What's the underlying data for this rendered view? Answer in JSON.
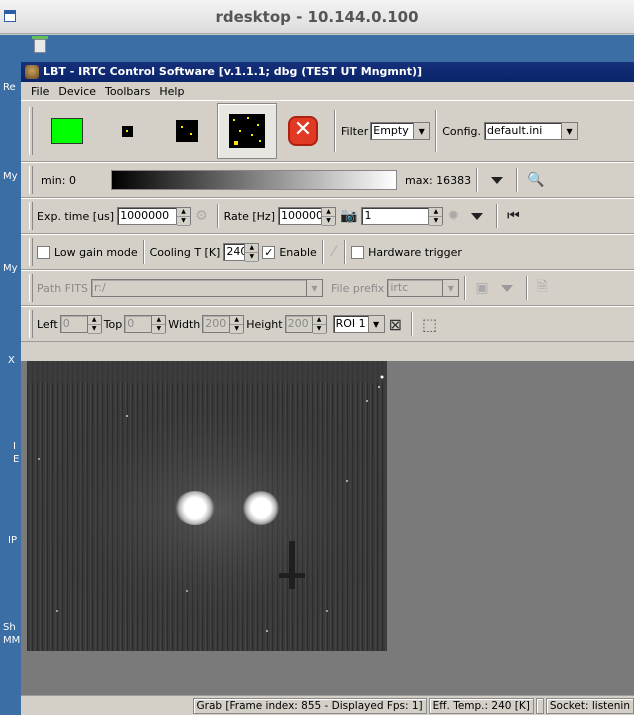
{
  "rdesktop": {
    "title": "rdesktop - 10.144.0.100"
  },
  "desktop": {
    "labels": [
      "Re",
      "My",
      "My",
      "X",
      "I",
      "E",
      "IP",
      "Sh",
      "MM"
    ]
  },
  "window": {
    "title": "LBT - IRTC Control Software [v.1.1.1; dbg (TEST UT Mngmnt)]",
    "menu": [
      "File",
      "Device",
      "Toolbars",
      "Help"
    ]
  },
  "acquisition": {
    "filter_label": "Filter",
    "filter_value": "Empty",
    "config_label": "Config.",
    "config_value": "default.ini",
    "stop_symbol": "✕"
  },
  "display": {
    "min_label": "min: 0",
    "max_label": "max: 16383"
  },
  "exposure": {
    "exp_label": "Exp. time [us]",
    "exp_value": "1000000",
    "rate_label": "Rate [Hz]",
    "rate_value": "100000",
    "frames_value": "1"
  },
  "options": {
    "low_gain_label": "Low gain mode",
    "low_gain_checked": "",
    "cooling_label": "Cooling T [K]",
    "cooling_value": "240",
    "enable_checked": "✓",
    "enable_label": "Enable",
    "hw_trigger_label": "Hardware trigger",
    "hw_trigger_checked": ""
  },
  "files": {
    "path_label": "Path FITS",
    "path_value": "r:/",
    "prefix_label": "File prefix",
    "prefix_value": "irtc"
  },
  "roi": {
    "left_label": "Left",
    "left_value": "0",
    "top_label": "Top",
    "top_value": "0",
    "width_label": "Width",
    "width_value": "200",
    "height_label": "Height",
    "height_value": "200",
    "roi_select": "ROI 1"
  },
  "status": {
    "grab": "Grab [Frame index: 855 - Displayed Fps: 1]",
    "temp": "Eff. Temp.: 240 [K]",
    "socket": "Socket: listenin"
  }
}
